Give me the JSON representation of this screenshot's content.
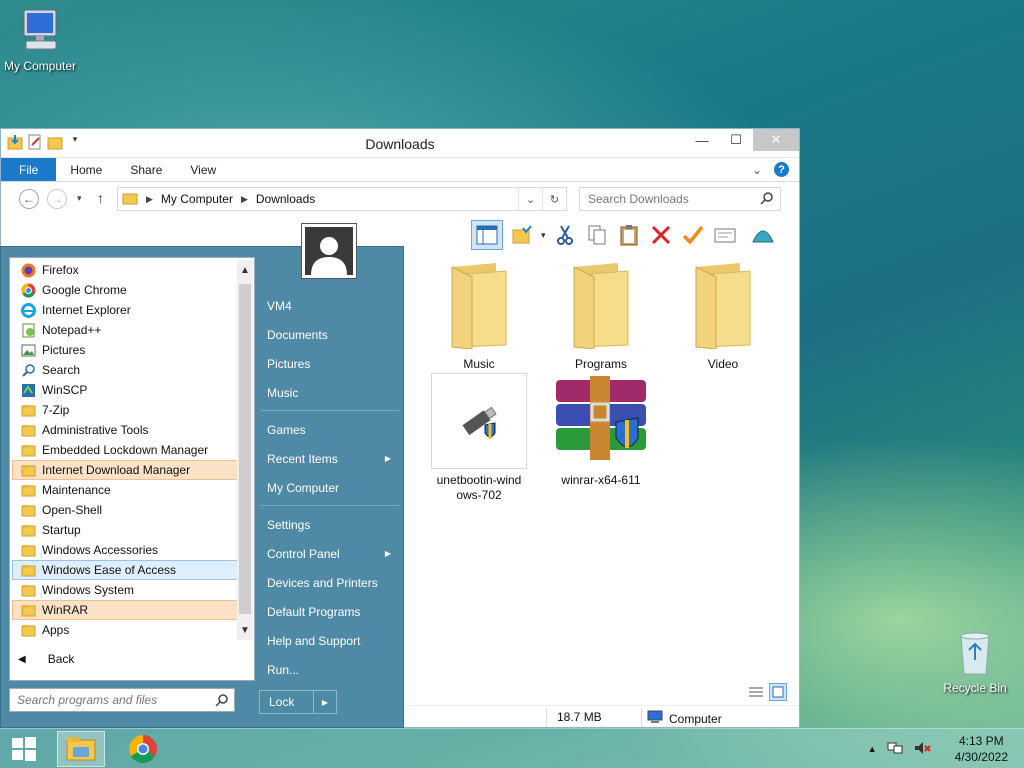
{
  "desktop": {
    "icons": [
      {
        "label": "My Computer",
        "icon": "computer-icon"
      },
      {
        "label": "Recycle Bin",
        "icon": "recycle-bin-icon"
      }
    ]
  },
  "explorer": {
    "title": "Downloads",
    "ribbon_tabs": [
      "File",
      "Home",
      "Share",
      "View"
    ],
    "breadcrumb": [
      "My Computer",
      "Downloads"
    ],
    "search_placeholder": "Search Downloads",
    "items": [
      {
        "name": "Music",
        "type": "folder"
      },
      {
        "name": "Programs",
        "type": "folder"
      },
      {
        "name": "Video",
        "type": "folder"
      },
      {
        "name": "unetbootin-windows-702",
        "display": "unetbootin-wind ows-702",
        "type": "application"
      },
      {
        "name": "winrar-x64-611",
        "type": "application"
      }
    ],
    "status": {
      "size": "18.7 MB",
      "location": "Computer"
    }
  },
  "start_menu": {
    "programs": [
      {
        "label": "Firefox",
        "icon": "firefox-icon"
      },
      {
        "label": "Google Chrome",
        "icon": "chrome-icon"
      },
      {
        "label": "Internet Explorer",
        "icon": "internet-explorer-icon"
      },
      {
        "label": "Notepad++",
        "icon": "notepad-plus-plus-icon"
      },
      {
        "label": "Pictures",
        "icon": "pictures-icon"
      },
      {
        "label": "Search",
        "icon": "search-icon"
      },
      {
        "label": "WinSCP",
        "icon": "winscp-icon"
      },
      {
        "label": "7-Zip",
        "icon": "folder-icon"
      },
      {
        "label": "Administrative Tools",
        "icon": "folder-icon"
      },
      {
        "label": "Embedded Lockdown Manager",
        "icon": "folder-icon"
      },
      {
        "label": "Internet Download Manager",
        "icon": "folder-icon",
        "highlight": "orange"
      },
      {
        "label": "Maintenance",
        "icon": "folder-icon"
      },
      {
        "label": "Open-Shell",
        "icon": "folder-icon"
      },
      {
        "label": "Startup",
        "icon": "folder-icon"
      },
      {
        "label": "Windows Accessories",
        "icon": "folder-icon"
      },
      {
        "label": "Windows Ease of Access",
        "icon": "folder-icon",
        "highlight": "blue"
      },
      {
        "label": "Windows System",
        "icon": "folder-icon"
      },
      {
        "label": "WinRAR",
        "icon": "folder-icon",
        "highlight": "orange"
      },
      {
        "label": "Apps",
        "icon": "folder-icon"
      }
    ],
    "back_label": "Back",
    "search_placeholder": "Search programs and files",
    "right_items": [
      {
        "label": "VM4"
      },
      {
        "label": "Documents"
      },
      {
        "label": "Pictures"
      },
      {
        "label": "Music"
      },
      {
        "label": "Games"
      },
      {
        "label": "Recent Items",
        "submenu": true
      },
      {
        "label": "My Computer"
      },
      {
        "label": "Settings"
      },
      {
        "label": "Control Panel",
        "submenu": true
      },
      {
        "label": "Devices and Printers"
      },
      {
        "label": "Default Programs"
      },
      {
        "label": "Help and Support"
      },
      {
        "label": "Run..."
      }
    ],
    "lock_label": "Lock"
  },
  "taskbar": {
    "pinned": [
      "start-button",
      "file-explorer",
      "google-chrome"
    ],
    "clock_time": "4:13 PM",
    "clock_date": "4/30/2022"
  },
  "colors": {
    "accent": "#1979ca",
    "start_menu_bg": "#4e8aa6",
    "highlight_orange": "#fbe2c7",
    "highlight_blue": "#dfeefb"
  }
}
